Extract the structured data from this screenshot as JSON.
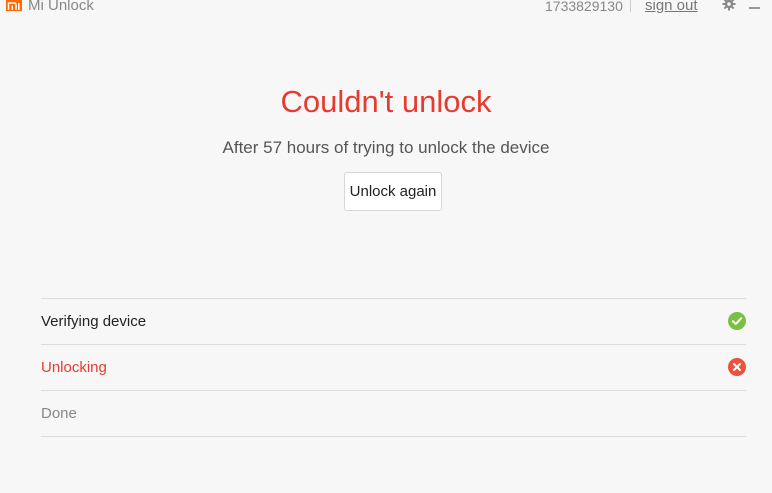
{
  "window": {
    "app_title": "Mi Unlock",
    "account_id": "1733829130",
    "sign_out_label": "sign out"
  },
  "icons": {
    "logo": "mi-logo-icon",
    "settings": "gear-icon",
    "minimize": "minimize-icon",
    "success": "check-circle-icon",
    "error": "x-circle-icon"
  },
  "colors": {
    "brand": "#ff6700",
    "error": "#e63b2e",
    "success": "#7ac143"
  },
  "main": {
    "headline": "Couldn't unlock",
    "subtitle": "After 57 hours of trying to unlock the device",
    "retry_button_label": "Unlock again"
  },
  "steps": [
    {
      "label": "Verifying device",
      "status": "success"
    },
    {
      "label": "Unlocking",
      "status": "failed"
    },
    {
      "label": "Done",
      "status": "pending"
    }
  ]
}
